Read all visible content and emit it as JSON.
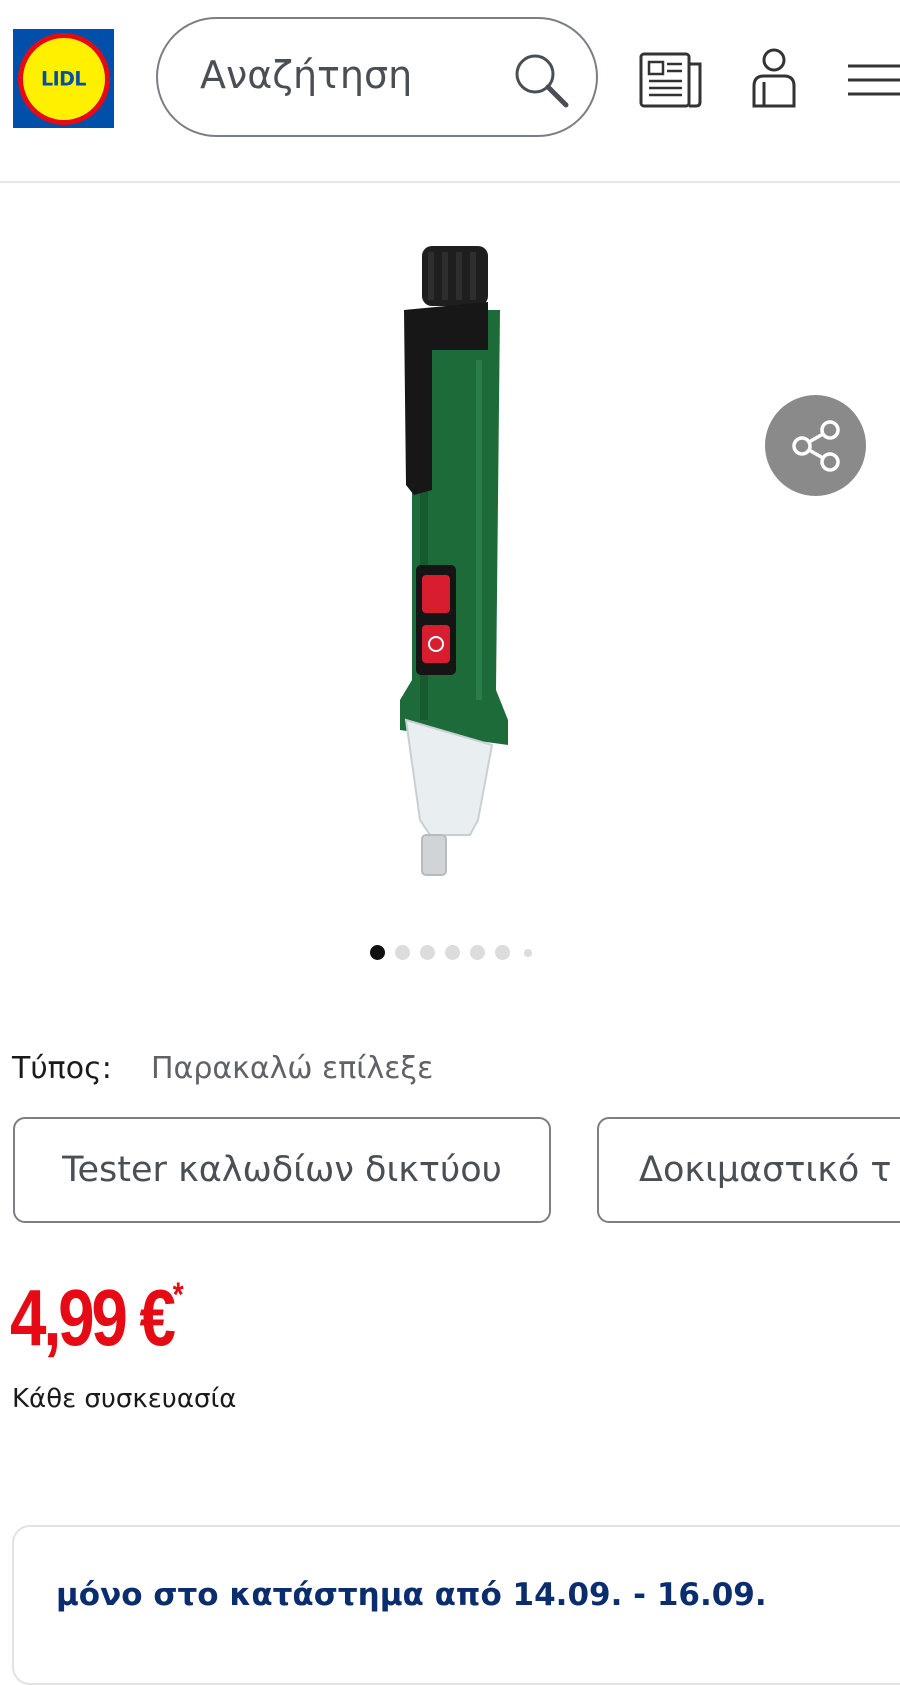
{
  "header": {
    "logo_text": "LIDL",
    "search_placeholder": "Αναζήτηση"
  },
  "product": {
    "gallery": {
      "image_count": 7,
      "active_index": 0
    },
    "type_label": "Τύπος:",
    "type_value": "Παρακαλώ επίλεξε",
    "variants": [
      {
        "label": "Tester καλωδίων δικτύου"
      },
      {
        "label": "Δοκιμαστικό τ"
      }
    ],
    "price": "4,99 €",
    "price_mark": "*",
    "unit": "Κάθε συσκευασία",
    "availability": "μόνο στο κατάστημα από 14.09. - 16.09."
  },
  "colors": {
    "price": "#e60a14",
    "availability_text": "#0a2d6e",
    "logo_blue": "#0050aa",
    "logo_yellow": "#fff000",
    "logo_red": "#e60a14",
    "share_bg": "#8a8a8a"
  },
  "icons": {
    "search": "search-icon",
    "flyer": "flyer-icon",
    "account": "account-icon",
    "menu": "menu-icon",
    "share": "share-icon"
  }
}
